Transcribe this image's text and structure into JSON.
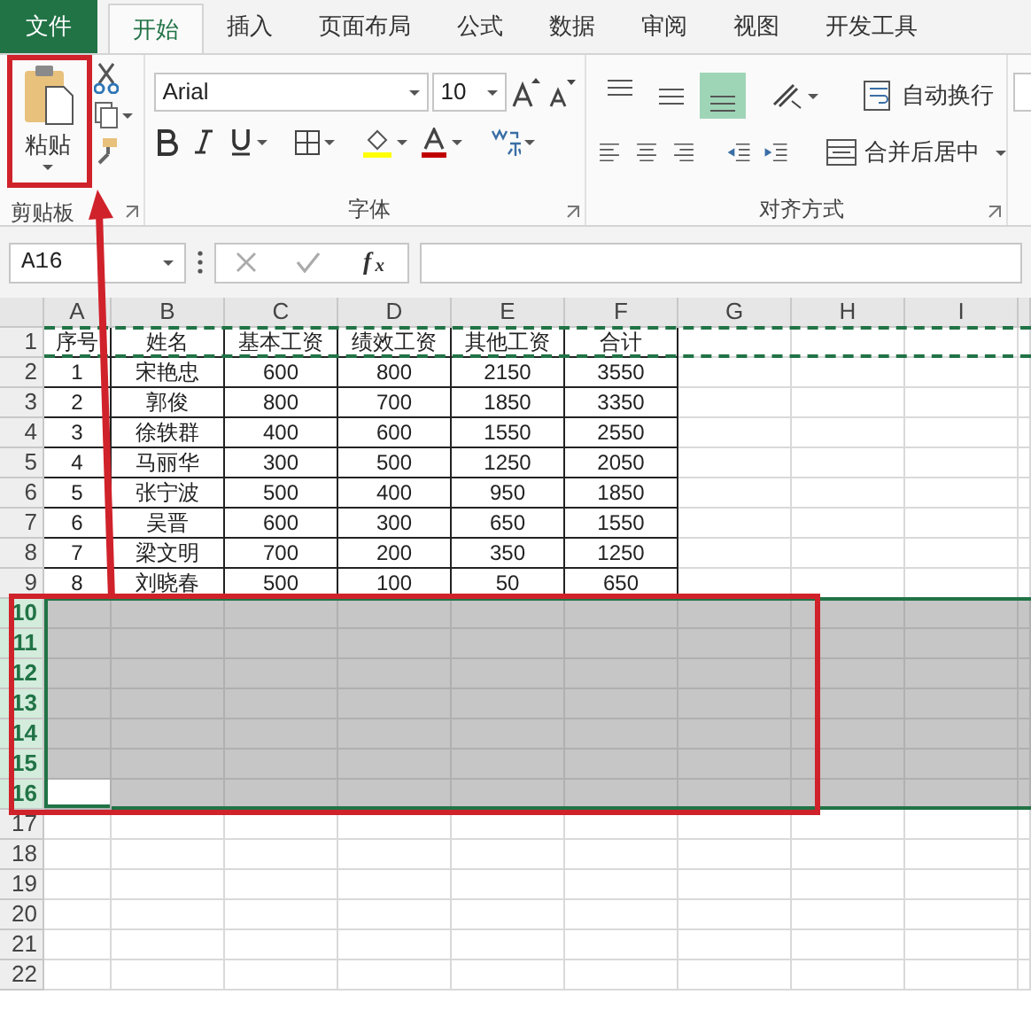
{
  "tabs": [
    {
      "label": "文件",
      "kind": "file",
      "selected": false
    },
    {
      "label": "开始",
      "kind": "tab",
      "selected": true
    },
    {
      "label": "插入",
      "kind": "tab",
      "selected": false
    },
    {
      "label": "页面布局",
      "kind": "tab",
      "selected": false
    },
    {
      "label": "公式",
      "kind": "tab",
      "selected": false
    },
    {
      "label": "数据",
      "kind": "tab",
      "selected": false
    },
    {
      "label": "审阅",
      "kind": "tab",
      "selected": false
    },
    {
      "label": "视图",
      "kind": "tab",
      "selected": false
    },
    {
      "label": "开发工具",
      "kind": "tab",
      "selected": false
    }
  ],
  "clipboard": {
    "paste_label": "粘贴",
    "group_label": "剪贴板"
  },
  "font": {
    "name": "Arial",
    "size": "10",
    "group_label": "字体"
  },
  "alignment": {
    "vertical": [
      {
        "selected": false
      },
      {
        "selected": false
      },
      {
        "selected": true
      }
    ],
    "wrap_label": "自动换行",
    "merge_label": "合并后居中",
    "group_label": "对齐方式"
  },
  "name_box": "A16",
  "function_label": "f$_{x}$",
  "columns": [
    "A",
    "B",
    "C",
    "D",
    "E",
    "F",
    "G",
    "H",
    "I"
  ],
  "rows": [
    {
      "number": "1",
      "cells": [
        "序号",
        "姓名",
        "基本工资",
        "绩效工资",
        "其他工资",
        "合计"
      ],
      "copied": true,
      "selected": false
    },
    {
      "number": "2",
      "cells": [
        "1",
        "宋艳忠",
        "600",
        "800",
        "2150",
        "3550"
      ],
      "copied": false,
      "selected": false
    },
    {
      "number": "3",
      "cells": [
        "2",
        "郭俊",
        "800",
        "700",
        "1850",
        "3350"
      ],
      "copied": false,
      "selected": false
    },
    {
      "number": "4",
      "cells": [
        "3",
        "徐轶群",
        "400",
        "600",
        "1550",
        "2550"
      ],
      "copied": false,
      "selected": false
    },
    {
      "number": "5",
      "cells": [
        "4",
        "马丽华",
        "300",
        "500",
        "1250",
        "2050"
      ],
      "copied": false,
      "selected": false
    },
    {
      "number": "6",
      "cells": [
        "5",
        "张宁波",
        "500",
        "400",
        "950",
        "1850"
      ],
      "copied": false,
      "selected": false
    },
    {
      "number": "7",
      "cells": [
        "6",
        "吴晋",
        "600",
        "300",
        "650",
        "1550"
      ],
      "copied": false,
      "selected": false
    },
    {
      "number": "8",
      "cells": [
        "7",
        "梁文明",
        "700",
        "200",
        "350",
        "1250"
      ],
      "copied": false,
      "selected": false
    },
    {
      "number": "9",
      "cells": [
        "8",
        "刘晓春",
        "500",
        "100",
        "50",
        "650"
      ],
      "copied": false,
      "selected": false
    },
    {
      "number": "10",
      "cells": [],
      "copied": false,
      "selected": true
    },
    {
      "number": "11",
      "cells": [],
      "copied": false,
      "selected": true
    },
    {
      "number": "12",
      "cells": [],
      "copied": false,
      "selected": true
    },
    {
      "number": "13",
      "cells": [],
      "copied": false,
      "selected": true
    },
    {
      "number": "14",
      "cells": [],
      "copied": false,
      "selected": true
    },
    {
      "number": "15",
      "cells": [],
      "copied": false,
      "selected": true
    },
    {
      "number": "16",
      "cells": [],
      "copied": false,
      "selected": true,
      "active_first_cell": true
    },
    {
      "number": "17",
      "cells": [],
      "copied": false,
      "selected": false
    },
    {
      "number": "18",
      "cells": [],
      "copied": false,
      "selected": false
    },
    {
      "number": "19",
      "cells": [],
      "copied": false,
      "selected": false
    },
    {
      "number": "20",
      "cells": [],
      "copied": false,
      "selected": false
    },
    {
      "number": "21",
      "cells": [],
      "copied": false,
      "selected": false
    },
    {
      "number": "22",
      "cells": [],
      "copied": false,
      "selected": false
    }
  ],
  "annotations": {
    "paste_box": true,
    "selection_box": true,
    "arrow": true
  }
}
